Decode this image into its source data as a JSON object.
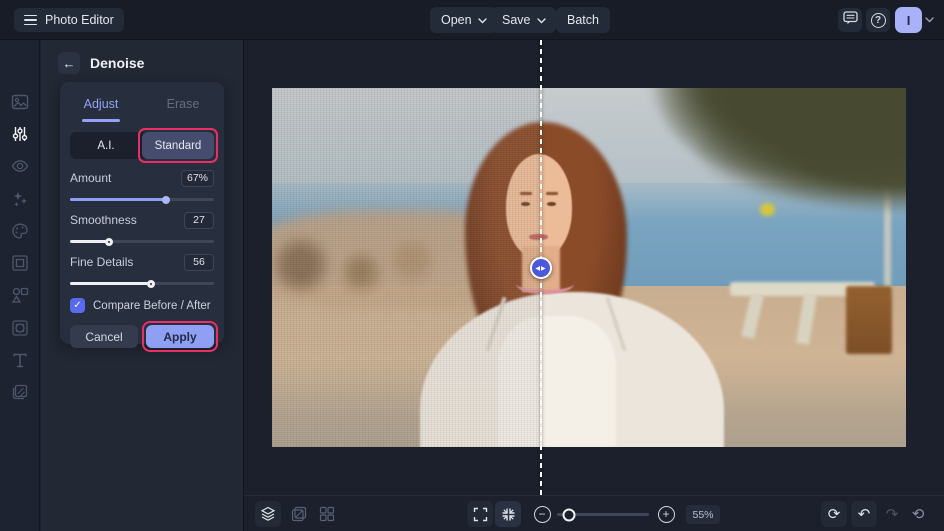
{
  "colors": {
    "accent": "#8fa0f4",
    "highlight_pink": "#ea2e68",
    "checkbox_blue": "#5a6aee",
    "avatar_bg": "#a9b2f8",
    "topbar_bg": "#171c27",
    "panel_bg": "#272e3d",
    "canvas_bg": "#1b202c"
  },
  "topbar": {
    "app_title": "Photo Editor",
    "open_label": "Open",
    "save_label": "Save",
    "batch_label": "Batch",
    "avatar_initial": "I"
  },
  "sidebar": {
    "icons": [
      "image-icon",
      "adjustments-icon",
      "eye-icon",
      "sparkles-icon",
      "palette-icon",
      "crop-frame-icon",
      "shapes-icon",
      "frame-icon",
      "text-icon",
      "overlays-icon"
    ],
    "active_index": 1
  },
  "panel": {
    "title": "Denoise",
    "tabs": [
      {
        "label": "Adjust",
        "active": true
      },
      {
        "label": "Erase",
        "active": false
      }
    ],
    "modes": [
      {
        "label": "A.I.",
        "selected": false
      },
      {
        "label": "Standard",
        "selected": true,
        "annotated": true
      }
    ],
    "sliders": [
      {
        "label": "Amount",
        "value": "67%",
        "percent": 67
      },
      {
        "label": "Smoothness",
        "value": "27",
        "percent": 27
      },
      {
        "label": "Fine Details",
        "value": "56",
        "percent": 56
      }
    ],
    "compare_label": "Compare Before / After",
    "compare_checked": "true",
    "cancel_label": "Cancel",
    "apply_label": "Apply"
  },
  "bottombar": {
    "zoom_value": "55%",
    "zoom_slider_percent": 13
  },
  "icons": {
    "back": "←",
    "help": "?",
    "check": "✓",
    "zoom_out": "−",
    "zoom_in": "+",
    "reset": "⟳",
    "undo": "↶",
    "redo": "↷",
    "history": "⟲",
    "handle_arrows": "◀▶"
  }
}
